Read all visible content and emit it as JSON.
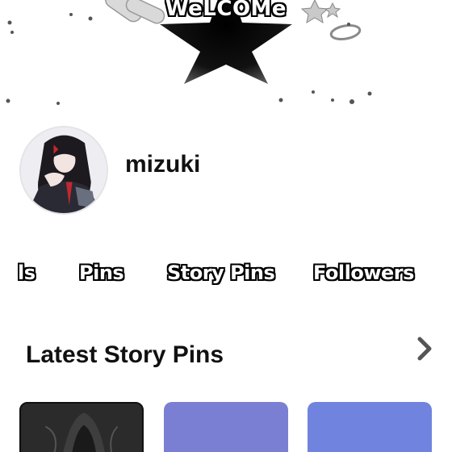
{
  "banner": {
    "welcome_text": "WeLCOMe"
  },
  "profile": {
    "username": "mizuki"
  },
  "tabs": [
    {
      "label": "ls"
    },
    {
      "label": "Pins"
    },
    {
      "label": "Story Pins"
    },
    {
      "label": "Followers"
    }
  ],
  "section": {
    "title": "Latest Story Pins"
  },
  "colors": {
    "card_2": "#7a7fd3",
    "card_3": "#6f83df",
    "card_1": "#2a2a2a"
  },
  "icons": {
    "next": "chevron-right-icon"
  }
}
